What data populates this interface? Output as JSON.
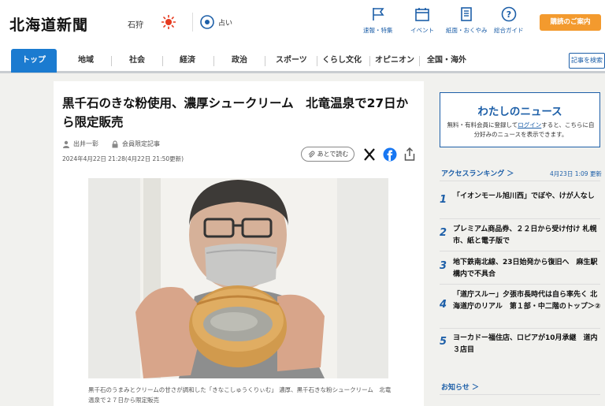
{
  "header": {
    "logo": "北海道新聞",
    "region": "石狩",
    "fortune_label": "占い",
    "nav": [
      {
        "label": "速報・特集",
        "icon": "flag-icon"
      },
      {
        "label": "イベント",
        "icon": "calendar-icon"
      },
      {
        "label": "紙面・おくやみ",
        "icon": "newspaper-icon"
      },
      {
        "label": "総合ガイド",
        "icon": "question-icon"
      }
    ],
    "cta_label": "購読のご案内"
  },
  "navbar": {
    "tabs": [
      "トップ",
      "地域",
      "社会",
      "経済",
      "政治",
      "スポーツ",
      "くらし文化",
      "オピニオン",
      "全国・海外"
    ],
    "active_tab": "トップ",
    "search_label": "記事を検索"
  },
  "article": {
    "title": "黒千石のきな粉使用、濃厚シュークリーム　北竜温泉で27日から限定販売",
    "author": "出井一彰",
    "member_label": "会員限定記事",
    "date": "2024年4月22日 21:28(4月22日 21:50更新)",
    "read_later_label": "あとで読む",
    "caption": "黒千石のうまみとクリームの甘さが調和した「きなこしゅうくりぃむ」 濃厚、黒千石きな粉シュークリーム　北竜温泉で２７日から限定販売"
  },
  "sidebar": {
    "mynews": {
      "title": "わたしのニュース",
      "desc_before": "無料・有料会員に登録して",
      "login_link": "ログイン",
      "desc_after": "すると、こちらに自分好みのニュースを表示できます。"
    },
    "ranking": {
      "heading": "アクセスランキング ＞",
      "timestamp": "4月23日 1:09 更新",
      "items": [
        {
          "num": "1",
          "text": "「イオンモール旭川西」でぼや、けが人なし"
        },
        {
          "num": "2",
          "text": "プレミアム商品券、２２日から受け付け 札幌市、紙と電子版で"
        },
        {
          "num": "3",
          "text": "地下鉄南北線、23日始発から復旧へ　麻生駅構内で不具合"
        },
        {
          "num": "4",
          "text": "「道庁スルー」夕張市長時代は自ら率先く 北海道庁のリアル　第１部・中二階のトップ＞②"
        },
        {
          "num": "5",
          "text": "ヨーカドー福住店、ロピアが10月承継　道内３店目"
        }
      ]
    },
    "notice_heading": "お知らせ ＞"
  },
  "colors": {
    "accent": "#1b7bd0",
    "link": "#1d5fa8",
    "cta": "#f39a2e"
  }
}
